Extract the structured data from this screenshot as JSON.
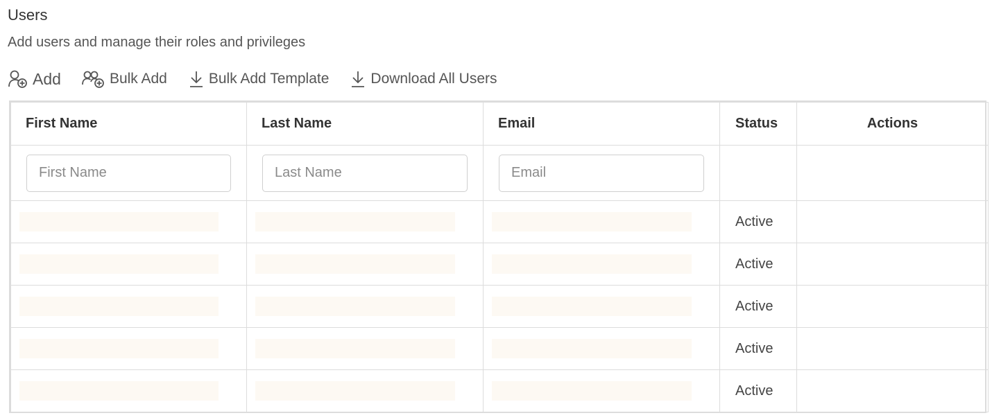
{
  "header": {
    "title": "Users",
    "subtitle": "Add users and manage their roles and privileges"
  },
  "toolbar": {
    "add_label": "Add",
    "bulk_add_label": "Bulk Add",
    "bulk_add_template_label": "Bulk Add Template",
    "download_all_label": "Download All Users",
    "icons": [
      "add-user-icon",
      "bulk-add-users-icon",
      "download-icon",
      "download-icon"
    ]
  },
  "table": {
    "columns": {
      "first_name": "First Name",
      "last_name": "Last Name",
      "email": "Email",
      "status": "Status",
      "actions": "Actions"
    },
    "filters": {
      "first_name_placeholder": "First Name",
      "last_name_placeholder": "Last Name",
      "email_placeholder": "Email"
    },
    "rows": [
      {
        "status": "Active"
      },
      {
        "status": "Active"
      },
      {
        "status": "Active"
      },
      {
        "status": "Active"
      },
      {
        "status": "Active"
      }
    ]
  },
  "colors": {
    "border": "#dcdcdc",
    "text": "#333333",
    "muted_text": "#555555",
    "redacted_fill": "#fdf9f3"
  }
}
